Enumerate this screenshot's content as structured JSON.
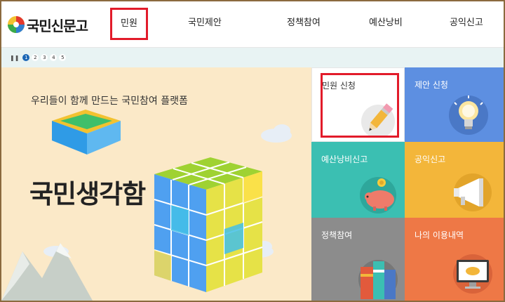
{
  "header": {
    "logo_text": "국민신문고",
    "nav": [
      {
        "label": "민원"
      },
      {
        "label": "국민제안"
      },
      {
        "label": "정책참여"
      },
      {
        "label": "예산낭비"
      },
      {
        "label": "공익신고"
      }
    ]
  },
  "pager": {
    "pages": [
      "1",
      "2",
      "3",
      "4",
      "5"
    ],
    "current": "1",
    "pause_icon": "pause-icon"
  },
  "banner": {
    "tagline": "우리들이 함께 만드는 국민참여 플랫폼",
    "title": "국민생각함"
  },
  "tiles": [
    {
      "label": "민원 신청",
      "icon": "pencil-icon"
    },
    {
      "label": "제안 신청",
      "icon": "lightbulb-icon"
    },
    {
      "label": "예산낭비신고",
      "icon": "piggy-bank-icon"
    },
    {
      "label": "공익신고",
      "icon": "megaphone-icon"
    },
    {
      "label": "정책참여",
      "icon": "books-icon"
    },
    {
      "label": "나의 이용내역",
      "icon": "monitor-icon"
    }
  ],
  "colors": {
    "active_highlight": "#e21b2a",
    "pager_active": "#1b66b5",
    "tile_proposal": "#5d8fe1",
    "tile_budget": "#3bbfb2",
    "tile_public_interest": "#f3b63a",
    "tile_policy": "#8c8c8c",
    "tile_history": "#ee7846",
    "banner_bg": "#fbe9c8"
  }
}
